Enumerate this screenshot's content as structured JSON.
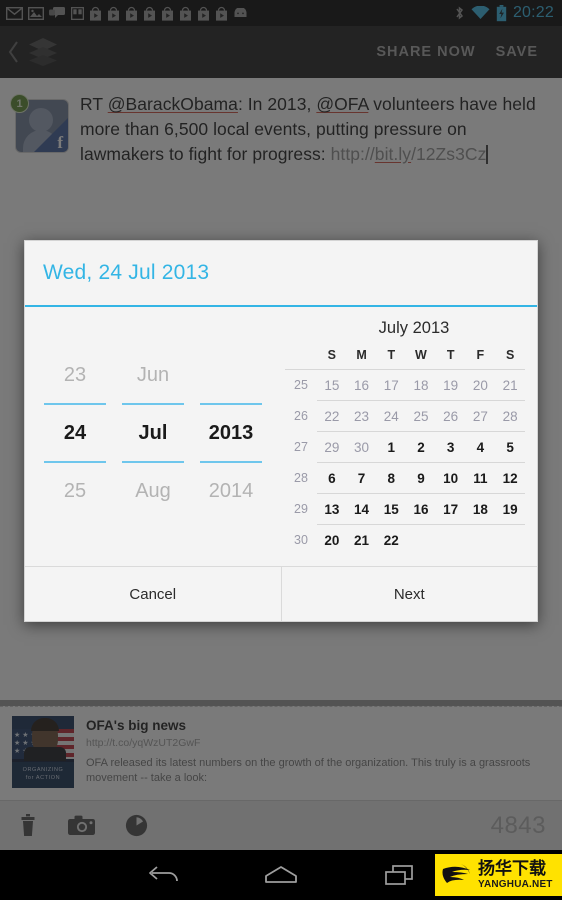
{
  "status_bar": {
    "clock": "20:22",
    "left_icons": [
      "mail-icon",
      "photo-icon",
      "chat-icon",
      "book-icon",
      "play-store-icon",
      "play-store-icon",
      "play-store-icon",
      "play-store-icon",
      "play-store-icon",
      "play-store-icon",
      "play-store-icon",
      "play-store-icon",
      "android-icon"
    ],
    "right_icons": [
      "bluetooth-icon",
      "wifi-icon",
      "battery-charging-icon"
    ],
    "clock_color": "#33b5e5",
    "background": "#000000"
  },
  "action_bar": {
    "up_icon": "back-chevron-icon",
    "app_icon": "buffer-stack-icon",
    "share_now_label": "SHARE NOW",
    "save_label": "SAVE",
    "background": "#1b1b1b",
    "text_color": "#a6a6a6"
  },
  "compose": {
    "avatar": {
      "badge_count": "1",
      "network_icon": "facebook-icon",
      "badge_color": "#5a8a2e"
    },
    "text_segments": [
      {
        "text": "RT ",
        "style": "plain"
      },
      {
        "text": "@BarackObama",
        "style": "misspelled"
      },
      {
        "text": ": In 2013, ",
        "style": "plain"
      },
      {
        "text": "@OFA",
        "style": "misspelled"
      },
      {
        "text": " volunteers have held more than 6,500 local events, putting pressure on lawmakers to fight for progress: ",
        "style": "plain"
      },
      {
        "text": "http://",
        "style": "url"
      },
      {
        "text": "bit.ly",
        "style": "url-misspelled"
      },
      {
        "text": "/12Zs3Cz",
        "style": "url"
      }
    ],
    "full_text": "RT @BarackObama: In 2013, @OFA volunteers have held more than 6,500 local events, putting pressure on lawmakers to fight for progress: http://bit.ly/12Zs3Cz"
  },
  "link_preview": {
    "title": "OFA's big news",
    "url": "http://t.co/yqWzUT2GwF",
    "description": "OFA released its latest numbers on the growth of the organization. This truly is a grassroots movement -- take a look:",
    "thumbnail": "obama-organizing-for-action-image",
    "thumbnail_caption_line1": "ORGANIZING",
    "thumbnail_caption_line2": "for ACTION"
  },
  "bottom_toolbar": {
    "icons": [
      "trash-icon",
      "camera-icon",
      "clock-icon"
    ],
    "char_count": "4843",
    "background": "#e8e8e8"
  },
  "nav_bar": {
    "buttons": [
      "back-nav-icon",
      "home-nav-icon",
      "recents-nav-icon"
    ],
    "watermark": {
      "chinese": "扬华下载",
      "latin": "YANGHUA.NET",
      "background": "#ffe200"
    }
  },
  "dialog": {
    "title": "Wed, 24 Jul 2013",
    "accent_color": "#33b5e5",
    "background": "#f4f4f4",
    "pickers": [
      {
        "name": "day",
        "prev": "23",
        "current": "24",
        "next": "25"
      },
      {
        "name": "month",
        "prev": "Jun",
        "current": "Jul",
        "next": "Aug"
      },
      {
        "name": "year",
        "prev": "",
        "current": "2013",
        "next": "2014"
      }
    ],
    "calendar": {
      "title": "July 2013",
      "weekday_headers": [
        "S",
        "M",
        "T",
        "W",
        "T",
        "F",
        "S"
      ],
      "week_header": "",
      "rows": [
        {
          "week": "25",
          "days": [
            {
              "d": "15",
              "out": true
            },
            {
              "d": "16",
              "out": true
            },
            {
              "d": "17",
              "out": true
            },
            {
              "d": "18",
              "out": true
            },
            {
              "d": "19",
              "out": true
            },
            {
              "d": "20",
              "out": true
            },
            {
              "d": "21",
              "out": true
            }
          ]
        },
        {
          "week": "26",
          "days": [
            {
              "d": "22",
              "out": true
            },
            {
              "d": "23",
              "out": true
            },
            {
              "d": "24",
              "out": true
            },
            {
              "d": "25",
              "out": true
            },
            {
              "d": "26",
              "out": true
            },
            {
              "d": "27",
              "out": true
            },
            {
              "d": "28",
              "out": true
            }
          ]
        },
        {
          "week": "27",
          "days": [
            {
              "d": "29",
              "out": true
            },
            {
              "d": "30",
              "out": true
            },
            {
              "d": "1",
              "out": false
            },
            {
              "d": "2",
              "out": false
            },
            {
              "d": "3",
              "out": false
            },
            {
              "d": "4",
              "out": false
            },
            {
              "d": "5",
              "out": false
            }
          ]
        },
        {
          "week": "28",
          "days": [
            {
              "d": "6",
              "out": false
            },
            {
              "d": "7",
              "out": false
            },
            {
              "d": "8",
              "out": false
            },
            {
              "d": "9",
              "out": false
            },
            {
              "d": "10",
              "out": false
            },
            {
              "d": "11",
              "out": false
            },
            {
              "d": "12",
              "out": false
            }
          ]
        },
        {
          "week": "29",
          "days": [
            {
              "d": "13",
              "out": false
            },
            {
              "d": "14",
              "out": false
            },
            {
              "d": "15",
              "out": false
            },
            {
              "d": "16",
              "out": false
            },
            {
              "d": "17",
              "out": false
            },
            {
              "d": "18",
              "out": false
            },
            {
              "d": "19",
              "out": false
            }
          ]
        },
        {
          "week": "30",
          "days": [
            {
              "d": "20",
              "out": false
            },
            {
              "d": "21",
              "out": false
            },
            {
              "d": "22",
              "out": false
            },
            {
              "d": "",
              "out": false
            },
            {
              "d": "",
              "out": false
            },
            {
              "d": "",
              "out": false
            },
            {
              "d": "",
              "out": false
            }
          ]
        }
      ]
    },
    "cancel_label": "Cancel",
    "next_label": "Next"
  }
}
